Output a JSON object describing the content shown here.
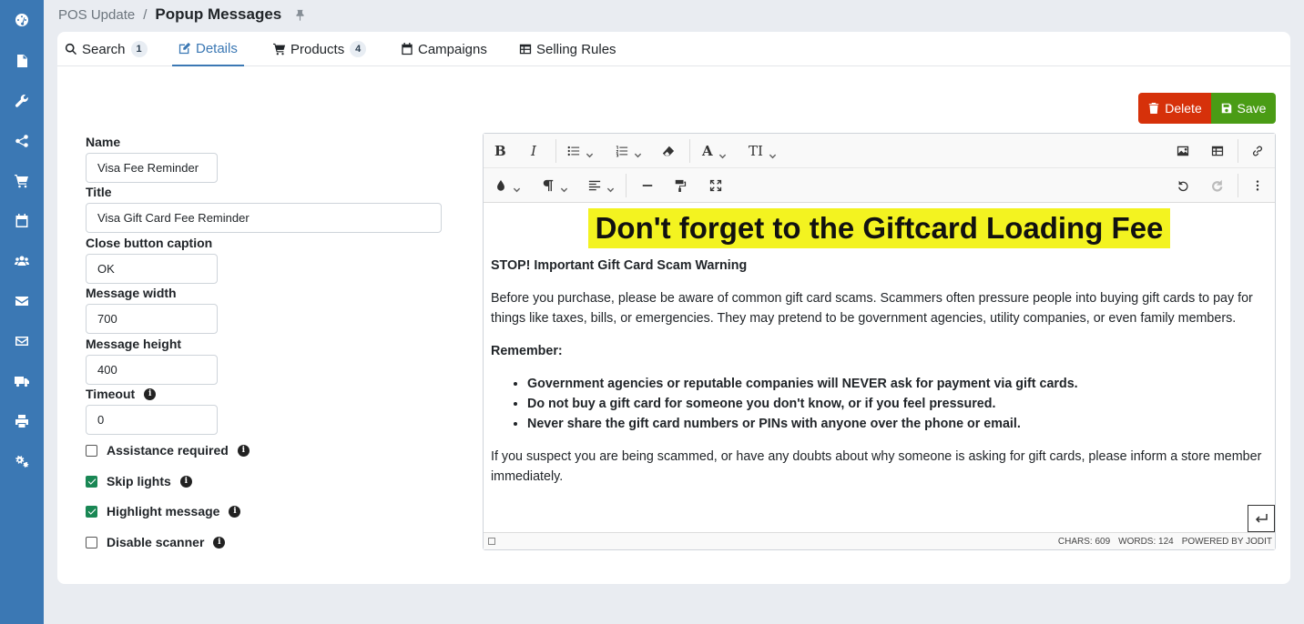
{
  "breadcrumb": {
    "parent": "POS Update",
    "separator": "/",
    "current": "Popup Messages"
  },
  "sidebar": {
    "icons": [
      "dashboard-icon",
      "document-icon",
      "wrench-icon",
      "share-icon",
      "cart-icon",
      "calendar-icon",
      "users-icon",
      "envelope-icon",
      "inbox-icon",
      "truck-icon",
      "printer-icon",
      "cogs-icon"
    ]
  },
  "tabs": [
    {
      "label": "Search",
      "badge": "1",
      "icon": "search-icon"
    },
    {
      "label": "Details",
      "badge": null,
      "icon": "edit-icon",
      "active": true
    },
    {
      "label": "Products",
      "badge": "4",
      "icon": "cart-icon"
    },
    {
      "label": "Campaigns",
      "badge": null,
      "icon": "calendar-icon"
    },
    {
      "label": "Selling Rules",
      "badge": null,
      "icon": "table-icon"
    }
  ],
  "actions": {
    "delete_label": "Delete",
    "save_label": "Save"
  },
  "form": {
    "name_label": "Name",
    "name_value": "Visa Fee Reminder",
    "title_label": "Title",
    "title_value": "Visa Gift Card Fee Reminder",
    "close_caption_label": "Close button caption",
    "close_caption_value": "OK",
    "width_label": "Message width",
    "width_value": "700",
    "height_label": "Message height",
    "height_value": "400",
    "timeout_label": "Timeout",
    "timeout_value": "0",
    "checkboxes": [
      {
        "label": "Assistance required",
        "checked": false
      },
      {
        "label": "Skip lights",
        "checked": true
      },
      {
        "label": "Highlight message",
        "checked": true
      },
      {
        "label": "Disable scanner",
        "checked": false
      }
    ]
  },
  "editor": {
    "headline": "Don't forget to the Giftcard Loading Fee",
    "warning": "STOP! Important Gift Card Scam Warning",
    "paragraph": "Before you purchase, please be aware of common gift card scams. Scammers often pressure people into buying gift cards to pay for things like taxes, bills, or emergencies. They may pretend to be government agencies, utility companies, or even family members.",
    "remember": "Remember:",
    "bullets": [
      "Government agencies or reputable companies will NEVER ask for payment via gift cards.",
      "Do not buy a gift card for someone you don't know, or if you feel pressured.",
      "Never share the gift card numbers or PINs with anyone over the phone or email."
    ],
    "closing": "If you suspect you are being scammed, or have any doubts about why someone is asking for gift cards, please inform a store member immediately.",
    "status": {
      "chars": "CHARS: 609",
      "words": "WORDS: 124",
      "powered": "POWERED BY JODIT"
    },
    "highlight_color": "#f3f320"
  },
  "colors": {
    "sidebar": "#3b78b4",
    "accent": "#3b78b4",
    "delete": "#d6310a",
    "save": "#4a9c15",
    "checkbox": "#198754"
  }
}
